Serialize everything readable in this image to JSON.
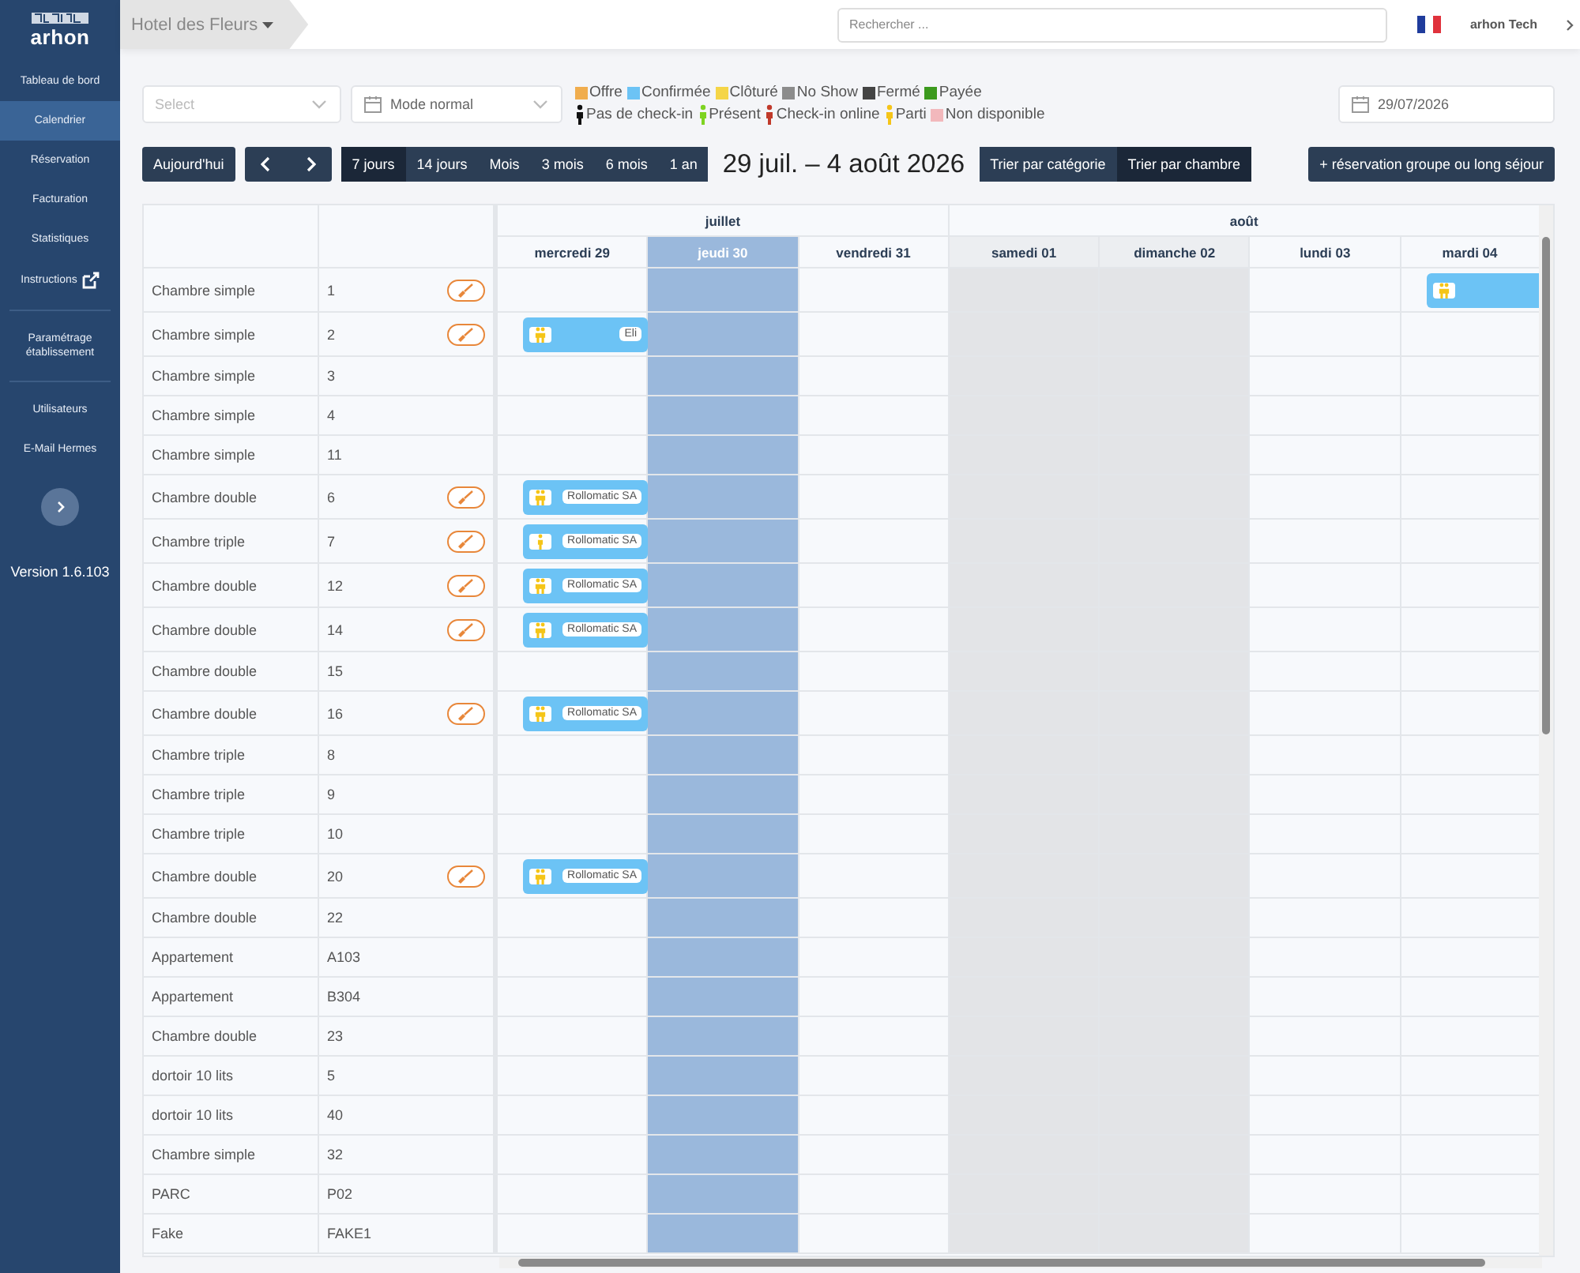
{
  "sidebar": {
    "logo": "arhon",
    "groups": [
      {
        "items": [
          {
            "label": "Tableau de bord",
            "selected": false,
            "kind": "link"
          },
          {
            "label": "Calendrier",
            "selected": true,
            "kind": "link"
          },
          {
            "label": "Réservation",
            "selected": false,
            "kind": "link"
          },
          {
            "label": "Facturation",
            "selected": false,
            "kind": "link"
          },
          {
            "label": "Statistiques",
            "selected": false,
            "kind": "link"
          },
          {
            "label": "Instructions",
            "selected": false,
            "kind": "external"
          }
        ]
      },
      {
        "items": [
          {
            "label": "Paramétrage établissement",
            "selected": false,
            "kind": "link"
          }
        ]
      },
      {
        "items": [
          {
            "label": "Utilisateurs",
            "selected": false,
            "kind": "link"
          },
          {
            "label": "E-Mail Hermes",
            "selected": false,
            "kind": "link"
          }
        ]
      }
    ],
    "version": "Version 1.6.103"
  },
  "topbar": {
    "hotel": "Hotel des Fleurs",
    "search": {
      "placeholder": "Rechercher ..."
    },
    "user": "arhon Tech"
  },
  "filters": {
    "select": {
      "placeholder": "Select"
    },
    "mode": {
      "value": "Mode normal"
    },
    "date": {
      "value": "29/07/2026"
    }
  },
  "legend": [
    {
      "label": "Offre",
      "color": "#f0ad4e",
      "kind": "swatch"
    },
    {
      "label": "Confirmée",
      "color": "#6cc3f5",
      "kind": "swatch"
    },
    {
      "label": "Clôturé",
      "color": "#f5d547",
      "kind": "swatch"
    },
    {
      "label": "No Show",
      "color": "#8c8c8c",
      "kind": "swatch"
    },
    {
      "label": "Fermé",
      "color": "#444444",
      "kind": "swatch"
    },
    {
      "label": "Payée",
      "color": "#3c9a1e",
      "kind": "swatch"
    },
    {
      "label": "Pas de check-in",
      "color": "#111111",
      "kind": "figure"
    },
    {
      "label": "Présent",
      "color": "#7ed321",
      "kind": "figure"
    },
    {
      "label": "Check-in online",
      "color": "#c0392b",
      "kind": "figure"
    },
    {
      "label": "Parti",
      "color": "#f5c518",
      "kind": "figure"
    },
    {
      "label": "Non disponible",
      "color": "#f2b8bc",
      "kind": "swatch"
    }
  ],
  "toolbar": {
    "today": "Aujourd'hui",
    "views": [
      {
        "label": "7 jours",
        "selected": true
      },
      {
        "label": "14 jours",
        "selected": false
      },
      {
        "label": "Mois",
        "selected": false
      },
      {
        "label": "3 mois",
        "selected": false
      },
      {
        "label": "6 mois",
        "selected": false
      },
      {
        "label": "1 an",
        "selected": false
      }
    ],
    "range": "29 juil. – 4 août 2026",
    "sort": [
      {
        "label": "Trier par catégorie",
        "selected": false
      },
      {
        "label": "Trier par chambre",
        "selected": true
      }
    ],
    "add": "+ réservation groupe ou long séjour"
  },
  "calendar": {
    "months": [
      {
        "label": "juillet",
        "days": [
          {
            "label": "mercredi 29",
            "today": false,
            "weekend": false
          },
          {
            "label": "jeudi 30",
            "today": true,
            "weekend": false
          },
          {
            "label": "vendredi 31",
            "today": false,
            "weekend": false
          }
        ]
      },
      {
        "label": "août",
        "days": [
          {
            "label": "samedi 01",
            "today": false,
            "weekend": true
          },
          {
            "label": "dimanche 02",
            "today": false,
            "weekend": true
          },
          {
            "label": "lundi 03",
            "today": false,
            "weekend": false
          },
          {
            "label": "mardi 04",
            "today": false,
            "weekend": false
          }
        ]
      }
    ],
    "rooms": [
      {
        "category": "Chambre simple",
        "room": "1",
        "needs_cleaning": true,
        "days": [
          {
            "kind": "free"
          },
          {
            "kind": "free"
          },
          {
            "kind": "free"
          },
          {
            "kind": "free"
          },
          {
            "kind": "free"
          },
          {
            "kind": "free"
          },
          {
            "kind": "couple"
          }
        ]
      },
      {
        "category": "Chambre simple",
        "room": "2",
        "needs_cleaning": true,
        "days": [
          {
            "kind": "couple",
            "label": "Eli"
          },
          {
            "kind": "free"
          },
          {
            "kind": "free"
          },
          {
            "kind": "free"
          },
          {
            "kind": "free"
          },
          {
            "kind": "free"
          },
          {
            "kind": "free"
          }
        ]
      },
      {
        "category": "Chambre simple",
        "room": "3",
        "needs_cleaning": false
      },
      {
        "category": "Chambre simple",
        "room": "4",
        "needs_cleaning": false
      },
      {
        "category": "Chambre simple",
        "room": "11",
        "needs_cleaning": false
      },
      {
        "category": "Chambre double",
        "room": "6",
        "needs_cleaning": true,
        "days": [
          {
            "kind": "couple",
            "label": "Rollomatic SA"
          },
          {
            "kind": "free"
          },
          {
            "kind": "free"
          },
          {
            "kind": "free"
          },
          {
            "kind": "free"
          },
          {
            "kind": "free"
          },
          {
            "kind": "free"
          }
        ]
      },
      {
        "category": "Chambre triple",
        "room": "7",
        "needs_cleaning": true,
        "days": [
          {
            "kind": "single",
            "label": "Rollomatic SA"
          },
          {
            "kind": "free"
          },
          {
            "kind": "free"
          },
          {
            "kind": "free"
          },
          {
            "kind": "free"
          },
          {
            "kind": "free"
          },
          {
            "kind": "free"
          }
        ]
      },
      {
        "category": "Chambre double",
        "room": "12",
        "needs_cleaning": true,
        "days": [
          {
            "kind": "couple",
            "label": "Rollomatic SA"
          },
          {
            "kind": "free"
          },
          {
            "kind": "free"
          },
          {
            "kind": "free"
          },
          {
            "kind": "free"
          },
          {
            "kind": "free"
          },
          {
            "kind": "free"
          }
        ]
      },
      {
        "category": "Chambre double",
        "room": "14",
        "needs_cleaning": true,
        "days": [
          {
            "kind": "couple",
            "label": "Rollomatic SA"
          },
          {
            "kind": "free"
          },
          {
            "kind": "free"
          },
          {
            "kind": "free"
          },
          {
            "kind": "free"
          },
          {
            "kind": "free"
          },
          {
            "kind": "free"
          }
        ]
      },
      {
        "category": "Chambre double",
        "room": "15",
        "needs_cleaning": false
      },
      {
        "category": "Chambre double",
        "room": "16",
        "needs_cleaning": true,
        "days": [
          {
            "kind": "couple",
            "label": "Rollomatic SA"
          },
          {
            "kind": "free"
          },
          {
            "kind": "free"
          },
          {
            "kind": "free"
          },
          {
            "kind": "free"
          },
          {
            "kind": "free"
          },
          {
            "kind": "free"
          }
        ]
      },
      {
        "category": "Chambre triple",
        "room": "8",
        "needs_cleaning": false
      },
      {
        "category": "Chambre triple",
        "room": "9",
        "needs_cleaning": false
      },
      {
        "category": "Chambre triple",
        "room": "10",
        "needs_cleaning": false
      },
      {
        "category": "Chambre double",
        "room": "20",
        "needs_cleaning": true,
        "days": [
          {
            "kind": "couple",
            "label": "Rollomatic SA"
          },
          {
            "kind": "free"
          },
          {
            "kind": "free"
          },
          {
            "kind": "free"
          },
          {
            "kind": "free"
          },
          {
            "kind": "free"
          },
          {
            "kind": "free"
          }
        ]
      },
      {
        "category": "Chambre double",
        "room": "22",
        "needs_cleaning": false
      },
      {
        "category": "Appartement",
        "room": "A103",
        "needs_cleaning": false
      },
      {
        "category": "Appartement",
        "room": "B304",
        "needs_cleaning": false
      },
      {
        "category": "Chambre double",
        "room": "23",
        "needs_cleaning": false
      },
      {
        "category": "dortoir 10 lits",
        "room": "5",
        "needs_cleaning": false
      },
      {
        "category": "dortoir 10 lits",
        "room": "40",
        "needs_cleaning": false
      },
      {
        "category": "Chambre simple",
        "room": "32",
        "needs_cleaning": false
      },
      {
        "category": "PARC",
        "room": "P02",
        "needs_cleaning": false
      },
      {
        "category": "Fake",
        "room": "FAKE1",
        "needs_cleaning": false
      }
    ]
  }
}
